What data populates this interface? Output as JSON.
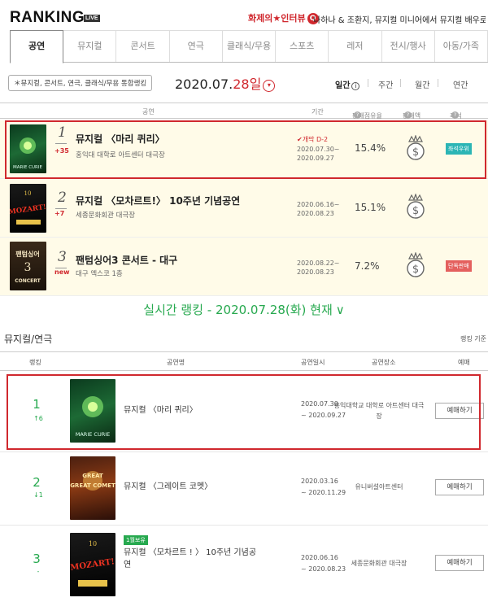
{
  "header": {
    "logo": "RANKING",
    "live": "LIVE",
    "promo": "화제의★인터뷰",
    "promo_icon": "Q",
    "ticker": "나하나 & 조환지, 뮤지컬 미니어에서 뮤지컬 배우로"
  },
  "tabs": [
    "공연",
    "뮤지컬",
    "콘서트",
    "연극",
    "클래식/무용",
    "스포츠",
    "레저",
    "전시/행사",
    "아동/가족"
  ],
  "subbar": {
    "pill": "＊뮤지컬, 콘서트, 연극, 클래식/무용 통합랭킹",
    "date_prefix": "2020.07.",
    "date_day": "28일",
    "date_icon": "▾",
    "periods": [
      "일간",
      "주간",
      "월간",
      "연간"
    ],
    "period_info_icon": "i"
  },
  "table1": {
    "headers": {
      "show": "공연",
      "period": "기간",
      "share": "판매점유율",
      "sales": "판매액",
      "score": "좌석"
    },
    "help_icon": "?",
    "rows": [
      {
        "rank": "1",
        "change": "+35",
        "title": "뮤지컬 〈마리 퀴리〉",
        "venue": "홍익대 대학로 아트센터 대극장",
        "badge": "✔개막 D-2",
        "period1": "2020.07.30~",
        "period2": "2020.09.27",
        "share": "15.4%",
        "tag": "좌석우위",
        "poster": "MARIE CURIE"
      },
      {
        "rank": "2",
        "change": "+7",
        "title": "뮤지컬 〈모차르트!〉 10주년 기념공연",
        "venue": "세종문화회관 대극장",
        "badge": "",
        "period1": "2020.06.16~",
        "period2": "2020.08.23",
        "share": "15.1%",
        "tag": "",
        "poster": "MOZART!"
      },
      {
        "rank": "3",
        "change": "new",
        "title": "팬텀싱어3 콘서트 - 대구",
        "venue": "대구 엑스코 1층",
        "badge": "",
        "period1": "2020.08.22~",
        "period2": "2020.08.23",
        "share": "7.2%",
        "tag": "단독판매",
        "poster": "CONCERT"
      }
    ]
  },
  "realtime": {
    "title": "실시간 랭킹 - 2020.07.28(화) 현재",
    "chevron": "∨"
  },
  "section": {
    "title": "뮤지컬/연극",
    "standard": "랭킹 기준"
  },
  "table2": {
    "headers": {
      "rank": "랭킹",
      "name": "공연명",
      "date": "공연일시",
      "venue": "공연장소",
      "book": "예매"
    },
    "rows": [
      {
        "rank": "1",
        "change": "↑6",
        "title": "뮤지컬 〈마리 퀴리〉",
        "date1": "2020.07.30",
        "date2": "~ 2020.09.27",
        "venue": "홍익대학교 대학로 아트센터 대극장",
        "book": "예매하기",
        "poster": "MARIE CURIE",
        "exclusive": ""
      },
      {
        "rank": "2",
        "change": "↓1",
        "title": "뮤지컬 〈그레이트 코멧〉",
        "date1": "2020.03.16",
        "date2": "~ 2020.11.29",
        "venue": "유니버설아트센터",
        "book": "예매하기",
        "poster": "GREAT COMET",
        "exclusive": ""
      },
      {
        "rank": "3",
        "change": "-",
        "title": "뮤지컬 〈모차르트 ! 〉 10주년 기념공",
        "title2": "연",
        "date1": "2020.06.16",
        "date2": "~ 2020.08.23",
        "venue": "세종문화회관 대극장",
        "book": "예매하기",
        "poster": "MOZART!",
        "exclusive": "1월보유"
      }
    ]
  },
  "colors": {
    "accent_red": "#d0282e",
    "accent_green": "#27a94f",
    "row_bg": "#fffbe8"
  }
}
